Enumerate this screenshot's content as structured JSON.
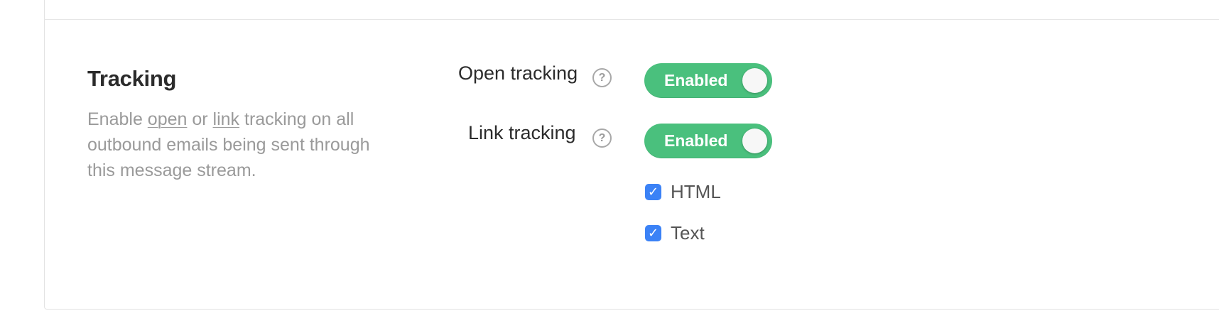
{
  "tracking": {
    "title": "Tracking",
    "description": {
      "prefix": "Enable ",
      "open_link": "open",
      "middle": " or ",
      "link_link": "link",
      "suffix": " tracking on all outbound emails being sent through this message stream."
    },
    "open_tracking": {
      "label": "Open tracking",
      "help_icon": "?",
      "toggle_label": "Enabled",
      "enabled": true
    },
    "link_tracking": {
      "label": "Link tracking",
      "help_icon": "?",
      "toggle_label": "Enabled",
      "enabled": true,
      "options": [
        {
          "label": "HTML",
          "checked": true,
          "check_glyph": "✓"
        },
        {
          "label": "Text",
          "checked": true,
          "check_glyph": "✓"
        }
      ]
    }
  },
  "colors": {
    "toggle_on": "#4ac07d",
    "checkbox_checked": "#3b82f6",
    "title_text": "#2b2b2b",
    "muted_text": "#9a9a9a"
  },
  "icons": {
    "help": "question-circle-icon",
    "check": "checkmark-icon"
  }
}
